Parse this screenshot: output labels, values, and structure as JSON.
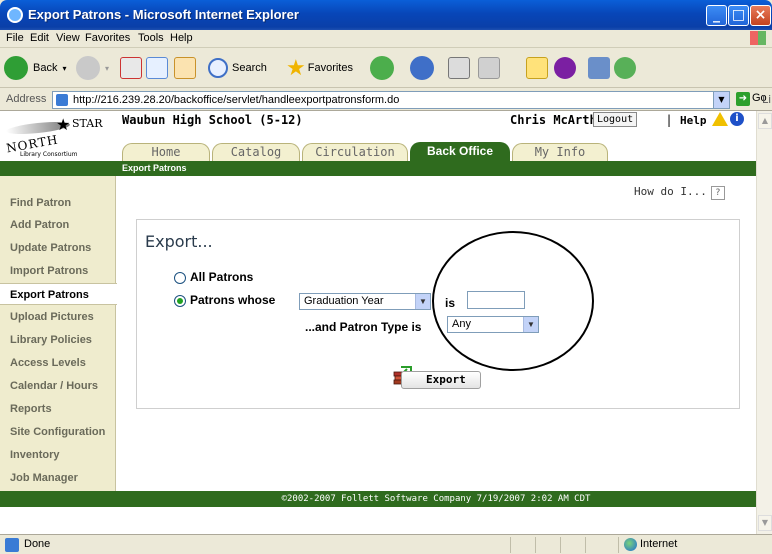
{
  "window": {
    "title": "Export Patrons - Microsoft Internet Explorer"
  },
  "menu": [
    "File",
    "Edit",
    "View",
    "Favorites",
    "Tools",
    "Help"
  ],
  "toolbar": {
    "back": "Back",
    "search": "Search",
    "favorites": "Favorites"
  },
  "address": {
    "label": "Address",
    "url": "http://216.239.28.20/backoffice/servlet/handleexportpatronsform.do",
    "go": "Go",
    "links": "Links"
  },
  "header": {
    "logo_north": "NORTH",
    "logo_star": "STAR",
    "logo_consortium": "Library Consortium",
    "school": "Waubun High School (5-12)",
    "user": "Chris McArthur",
    "logout": "Logout",
    "separator": "|",
    "help": "Help"
  },
  "tabs": [
    "Home",
    "Catalog",
    "Circulation",
    "Back Office",
    "My Info"
  ],
  "breadcrumb": "Export Patrons",
  "sidebar": [
    "Find Patron",
    "Add Patron",
    "Update Patrons",
    "Import Patrons",
    "Export Patrons",
    "Upload Pictures",
    "Library Policies",
    "Access Levels",
    "Calendar / Hours",
    "Reports",
    "Site Configuration",
    "Inventory",
    "Job Manager"
  ],
  "howdo": {
    "label": "How do I...",
    "q": "?"
  },
  "export": {
    "title": "Export...",
    "all_patrons": "All Patrons",
    "patrons_whose": "Patrons whose",
    "field_value": "Graduation Year",
    "is": "is",
    "value_input": "",
    "patron_type_label": "...and Patron Type is",
    "patron_type_value": "Any",
    "button": "Export"
  },
  "footer": "©2002-2007  Follett Software Company    7/19/2007 2:02 AM CDT",
  "status": {
    "done": "Done",
    "zone": "Internet"
  }
}
